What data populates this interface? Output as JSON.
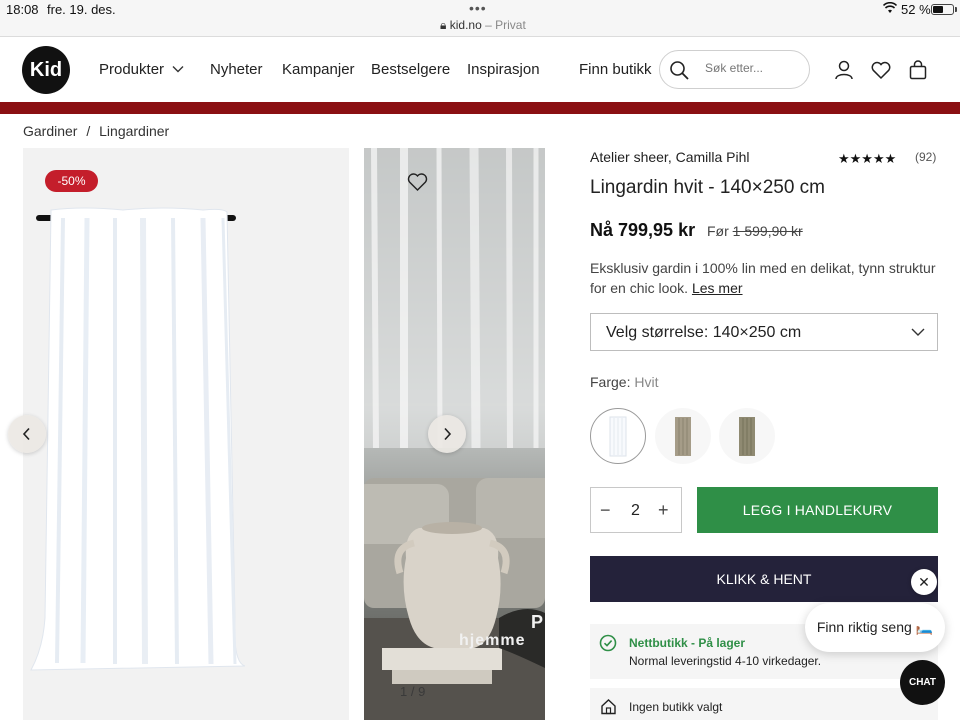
{
  "status_bar": {
    "time": "18:08",
    "date": "fre. 19. des.",
    "url": "kid.no",
    "url_suffix": "– Privat",
    "battery": "52 %"
  },
  "header": {
    "logo": "Kid",
    "nav": [
      "Produkter",
      "Nyheter",
      "Kampanjer",
      "Bestselgere",
      "Inspirasjon"
    ],
    "finn_butikk": "Finn butikk",
    "search_placeholder": "Søk etter..."
  },
  "breadcrumb": [
    "Gardiner",
    "/",
    "Lingardiner"
  ],
  "gallery": {
    "badge": "-50%",
    "overlay_line1": "hjemme",
    "overlay_line2": "P",
    "counter": "1 / 9"
  },
  "product": {
    "brand": "Atelier sheer, Camilla Pihl",
    "rating_stars": "★★★★★",
    "reviews": "(92)",
    "title": "Lingardin hvit - 140×250 cm",
    "price_now": "Nå 799,95 kr",
    "price_before_prefix": "Før",
    "price_before": "1 599,90 kr",
    "description": "Eksklusiv gardin i 100% lin med en delikat, tynn struktur for en chic look.",
    "read_more": "Les mer",
    "size_select": "Velg størrelse: 140×250 cm",
    "color_label": "Farge:",
    "color_value": "Hvit",
    "quantity": "2",
    "minus": "−",
    "plus": "+",
    "add_to_cart": "LEGG I HANDLEKURV",
    "click_collect": "KLIKK & HENT",
    "stock_title": "Nettbutikk - På lager",
    "stock_text": "Normal leveringstid 4-10 virkedager.",
    "store_title": "Ingen butikk valgt"
  },
  "chat": {
    "close": "✕",
    "bubble": "Finn riktig seng 🛏️",
    "button": "CHAT"
  },
  "colors": {
    "sale_red": "#c41e2b",
    "promo_bar": "#8a0f12",
    "cart_green": "#2f8f47",
    "klikk_navy": "#24223a"
  }
}
